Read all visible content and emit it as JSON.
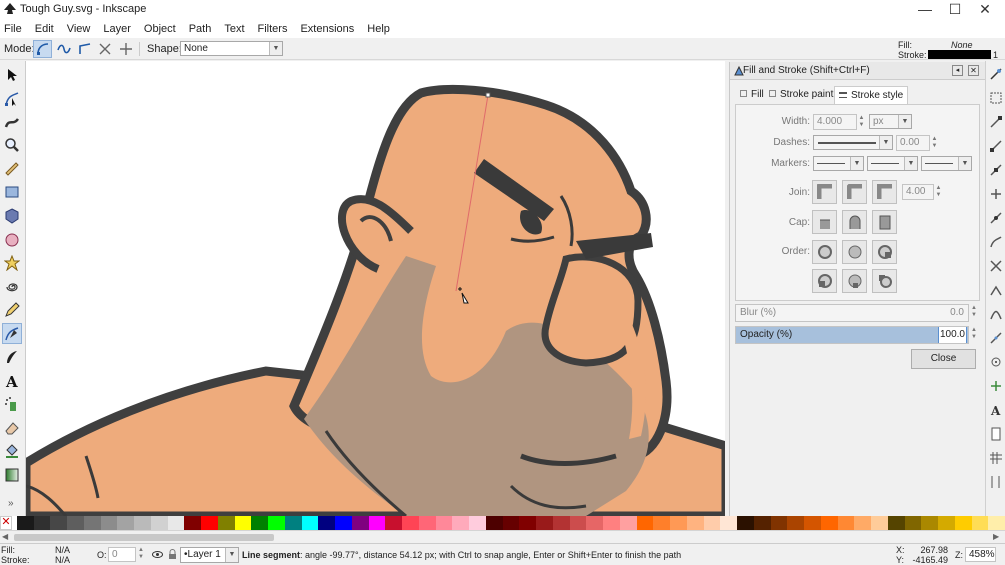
{
  "window": {
    "title": "Tough Guy.svg - Inkscape",
    "controls": {
      "minimize": "—",
      "maximize": "☐",
      "close": "✕"
    }
  },
  "menu": [
    "File",
    "Edit",
    "View",
    "Layer",
    "Object",
    "Path",
    "Text",
    "Filters",
    "Extensions",
    "Help"
  ],
  "tool_controls": {
    "mode_label": "Mode:",
    "shape_label": "Shape:",
    "shape_value": "None",
    "mode_icons": [
      "bezier-mode-icon",
      "spiro-mode-icon",
      "bspline-mode-icon",
      "paraxial-mode-icon",
      "sequence-mode-icon"
    ]
  },
  "style_indicator": {
    "fill_label": "Fill:",
    "fill_value": "None",
    "stroke_label": "Stroke:",
    "stroke_width": "1",
    "stroke_color": "#000000"
  },
  "toolbox": [
    "selector-tool-icon",
    "node-tool-icon",
    "tweak-tool-icon",
    "zoom-tool-icon",
    "measure-tool-icon",
    "rect-tool-icon",
    "3dbox-tool-icon",
    "ellipse-tool-icon",
    "star-tool-icon",
    "spiral-tool-icon",
    "pencil-tool-icon",
    "pen-tool-icon",
    "calligraphy-tool-icon",
    "text-tool-icon",
    "spray-tool-icon",
    "eraser-tool-icon",
    "bucket-tool-icon",
    "gradient-tool-icon"
  ],
  "toolbox_more": "»",
  "dialog": {
    "title": "Fill and Stroke (Shift+Ctrl+F)",
    "tabs": [
      "Fill",
      "Stroke paint",
      "Stroke style"
    ],
    "active_tab": "Stroke style",
    "width_label": "Width:",
    "width_value": "4.000",
    "width_unit": "px",
    "dashes_label": "Dashes:",
    "dashes_value": "0.00",
    "markers_label": "Markers:",
    "join_label": "Join:",
    "miter_value": "4.00",
    "cap_label": "Cap:",
    "order_label": "Order:",
    "blur_label": "Blur (%)",
    "blur_value": "0.0",
    "opacity_label": "Opacity (%)",
    "opacity_value": "100.0",
    "opacity_fraction": 1.0,
    "close_label": "Close"
  },
  "palette": [
    "#ffffff",
    "#1a1a1a",
    "#303030",
    "#474747",
    "#5e5e5e",
    "#757575",
    "#8c8c8c",
    "#a3a3a3",
    "#bababa",
    "#d1d1d1",
    "#e8e8e8",
    "#800000",
    "#ff0000",
    "#808000",
    "#ffff00",
    "#008000",
    "#00ff00",
    "#008080",
    "#00ffff",
    "#000080",
    "#0000ff",
    "#800080",
    "#ff00ff",
    "#c8102e",
    "#ff4455",
    "#ff6677",
    "#ff8899",
    "#ffaabb",
    "#ffccdd",
    "#4d0000",
    "#660000",
    "#800000",
    "#991a1a",
    "#b33333",
    "#cc4d4d",
    "#e66666",
    "#ff8080",
    "#ffa0a0",
    "#ff6600",
    "#ff7f2a",
    "#ff9955",
    "#ffb380",
    "#ffccaa",
    "#ffe6d5",
    "#2b1100",
    "#552200",
    "#803300",
    "#aa4400",
    "#d45500",
    "#ff6600",
    "#ff8833",
    "#ffaa66",
    "#ffcc99",
    "#554400",
    "#806600",
    "#aa8800",
    "#d4aa00",
    "#ffcc00",
    "#ffdd55",
    "#ffeeaa"
  ],
  "status": {
    "fill_label": "Fill:",
    "fill_value": "N/A",
    "stroke_label": "Stroke:",
    "stroke_value": "N/A",
    "opacity_label": "O:",
    "opacity_value": "0",
    "layer": "•Layer 1",
    "message_bold": "Line segment",
    "message": ": angle -99.77°, distance 54.12 px; with Ctrl to snap angle, Enter or Shift+Enter to finish the path",
    "x_label": "X:",
    "x_value": "267.98",
    "y_label": "Y:",
    "y_value": "-4165.49",
    "zoom_label": "Z:",
    "zoom_value": "458%"
  },
  "colors": {
    "skin": "#eeab7c",
    "beard": "#b09580",
    "outline": "#3f3f3f",
    "accent": "#5a8fd0"
  }
}
